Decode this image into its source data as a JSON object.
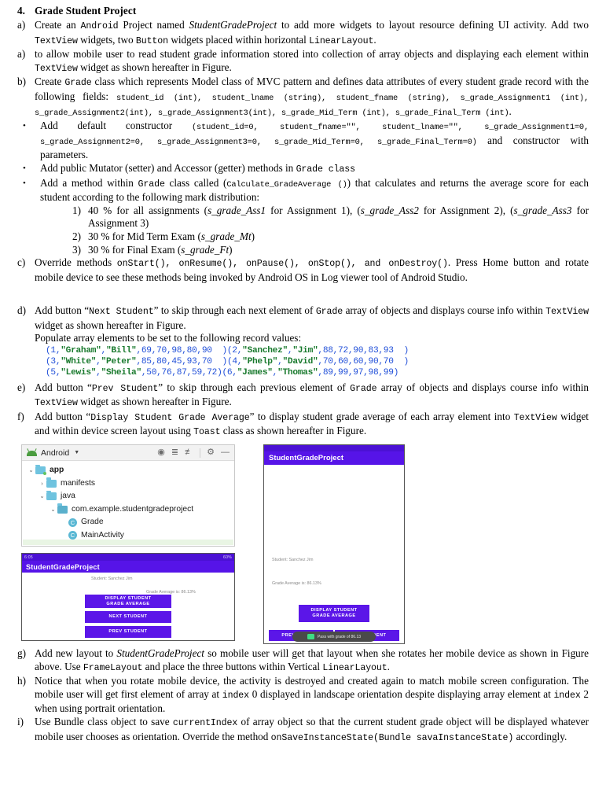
{
  "document": {
    "title_number": "4.",
    "title": "Grade Student Project",
    "items": [
      {
        "marker": "a)",
        "parts": [
          {
            "t": "Create an ",
            "s": "n"
          },
          {
            "t": "Android",
            "s": "m"
          },
          {
            "t": " Project named ",
            "s": "n"
          },
          {
            "t": "StudentGradeProject",
            "s": "i"
          },
          {
            "t": " to add more widgets to layout resource defining UI activity. Add two ",
            "s": "n"
          },
          {
            "t": "TextView",
            "s": "m"
          },
          {
            "t": " widgets, two ",
            "s": "n"
          },
          {
            "t": "Button",
            "s": "m"
          },
          {
            "t": "  widgets placed within horizontal ",
            "s": "n"
          },
          {
            "t": "LinearLayout",
            "s": "m"
          },
          {
            "t": ".",
            "s": "n"
          }
        ]
      },
      {
        "marker": "a)",
        "parts": [
          {
            "t": "to allow mobile user to read student grade information stored into collection of array objects and displaying each element within ",
            "s": "n"
          },
          {
            "t": "TextView",
            "s": "m"
          },
          {
            "t": " widget as shown hereafter in Figure.",
            "s": "n"
          }
        ]
      },
      {
        "marker": "b)",
        "parts": [
          {
            "t": "Create ",
            "s": "n"
          },
          {
            "t": "Grade",
            "s": "m"
          },
          {
            "t": " class which represents Model class of MVC pattern and defines data attributes of every student grade record with the following fields: ",
            "s": "n"
          },
          {
            "t": "student_id (int), student_lname (string), student_fname (string), s_grade_Assignment1 (int), s_grade_Assignment2(int), s_grade_Assignment3(int), s_grade_Mid_Term (int),  s_grade_Final_Term (int)",
            "s": "ms"
          },
          {
            "t": ".",
            "s": "n"
          }
        ]
      },
      {
        "marker": "•",
        "parts": [
          {
            "t": "Add default constructor ",
            "s": "n"
          },
          {
            "t": "(student_id=0,    student_fname=\"\",    student_lname=\"\", s_grade_Assignment1=0,            s_grade_Assignment2=0,            s_grade_Assignment3=0, s_grade_Mid_Term=0,  s_grade_Final_Term=0)",
            "s": "ms"
          },
          {
            "t": " and constructor with parameters.",
            "s": "n"
          }
        ]
      },
      {
        "marker": "•",
        "parts": [
          {
            "t": "Add public Mutator (setter) and Accessor (getter) methods in ",
            "s": "n"
          },
          {
            "t": "Grade  class",
            "s": "m"
          }
        ]
      },
      {
        "marker": "•",
        "parts": [
          {
            "t": "Add a method within ",
            "s": "n"
          },
          {
            "t": "Grade",
            "s": "m"
          },
          {
            "t": " class called (",
            "s": "n"
          },
          {
            "t": "Calculate_GradeAverage ()",
            "s": "ms"
          },
          {
            "t": ") that calculates and returns the average score for each student according to the following mark distribution:",
            "s": "n"
          }
        ]
      }
    ],
    "sub_items": [
      {
        "marker": "1)",
        "parts": [
          {
            "t": "40 % for all assignments (",
            "s": "n"
          },
          {
            "t": "s_grade_Ass1",
            "s": "i"
          },
          {
            "t": "  for Assignment 1), (",
            "s": "n"
          },
          {
            "t": "s_grade_Ass2",
            "s": "i"
          },
          {
            "t": " for Assignment 2), (",
            "s": "n"
          },
          {
            "t": "s_grade_Ass3",
            "s": "i"
          },
          {
            "t": " for Assignment 3)",
            "s": "n"
          }
        ]
      },
      {
        "marker": "2)",
        "parts": [
          {
            "t": "30 % for Mid Term Exam (",
            "s": "n"
          },
          {
            "t": "s_grade_Mt",
            "s": "i"
          },
          {
            "t": ")",
            "s": "n"
          }
        ]
      },
      {
        "marker": "3)",
        "parts": [
          {
            "t": "30 % for Final Exam (",
            "s": "n"
          },
          {
            "t": "s_grade_Ft",
            "s": "i"
          },
          {
            "t": ")",
            "s": "n"
          }
        ]
      }
    ],
    "item_c": {
      "marker": "c)",
      "parts": [
        {
          "t": "Override methods ",
          "s": "n"
        },
        {
          "t": "onStart(),  onResume(),  onPause(),  onStop(),  and onDestroy()",
          "s": "m"
        },
        {
          "t": ". Press Home button and rotate mobile device to see these methods being invoked by Android OS in Log viewer tool of Android Studio.",
          "s": "n"
        }
      ]
    },
    "item_d": {
      "marker": "d)",
      "parts": [
        {
          "t": "Add button “",
          "s": "n"
        },
        {
          "t": "Next Student",
          "s": "m"
        },
        {
          "t": "” to skip through each next element of ",
          "s": "n"
        },
        {
          "t": "Grade",
          "s": "m"
        },
        {
          "t": " array of objects and displays course info within ",
          "s": "n"
        },
        {
          "t": "TextView",
          "s": "m"
        },
        {
          "t": " widget as shown hereafter in Figure.",
          "s": "n"
        }
      ]
    },
    "populate_label": "Populate array elements to be set to the following record values:",
    "item_e": {
      "marker": "e)",
      "parts": [
        {
          "t": "Add button “",
          "s": "n"
        },
        {
          "t": "Prev Student",
          "s": "m"
        },
        {
          "t": "” to skip through each previous element of ",
          "s": "n"
        },
        {
          "t": "Grade",
          "s": "m"
        },
        {
          "t": " array of objects and displays course info within ",
          "s": "n"
        },
        {
          "t": "TextView",
          "s": "m"
        },
        {
          "t": " widget as shown hereafter in Figure.",
          "s": "n"
        }
      ]
    },
    "item_f": {
      "marker": "f)",
      "parts": [
        {
          "t": "Add button “",
          "s": "n"
        },
        {
          "t": "Display Student Grade Average",
          "s": "m"
        },
        {
          "t": "” to display student grade average of each array element into ",
          "s": "n"
        },
        {
          "t": "TextView",
          "s": "m"
        },
        {
          "t": " widget and within device screen layout using ",
          "s": "n"
        },
        {
          "t": "Toast",
          "s": "m"
        },
        {
          "t": " class as shown hereafter in Figure.",
          "s": "n"
        }
      ]
    },
    "item_g": {
      "marker": "g)",
      "parts": [
        {
          "t": "Add new layout to ",
          "s": "n"
        },
        {
          "t": "StudentGradeProject",
          "s": "i"
        },
        {
          "t": " so mobile user will get that layout when she rotates her mobile device as shown in Figure above. Use ",
          "s": "n"
        },
        {
          "t": "FrameLayout",
          "s": "m"
        },
        {
          "t": " and place the three buttons within Vertical ",
          "s": "n"
        },
        {
          "t": "LinearLayout",
          "s": "m"
        },
        {
          "t": ".",
          "s": "n"
        }
      ]
    },
    "item_h": {
      "marker": "h)",
      "parts": [
        {
          "t": "Notice that when you rotate mobile device, the activity is destroyed and created again to match mobile screen configuration. The mobile user will get first element of array at ",
          "s": "n"
        },
        {
          "t": "index",
          "s": "m"
        },
        {
          "t": " 0 displayed in landscape orientation despite displaying array element at ",
          "s": "n"
        },
        {
          "t": "index",
          "s": "m"
        },
        {
          "t": " 2 when using portrait orientation.",
          "s": "n"
        }
      ]
    },
    "item_i": {
      "marker": "i)",
      "parts": [
        {
          "t": "Use Bundle class object to save ",
          "s": "n"
        },
        {
          "t": "currentIndex",
          "s": "m"
        },
        {
          "t": " of array object so that the current student grade object will be displayed whatever mobile user chooses as orientation. Override the method ",
          "s": "n"
        },
        {
          "t": "onSaveInstanceState(Bundle  savaInstanceState)",
          "s": "m"
        },
        {
          "t": " accordingly.",
          "s": "n"
        }
      ]
    },
    "records": [
      [
        {
          "t": "(1,",
          "c": "blue"
        },
        {
          "t": "\"Graham\"",
          "c": "green"
        },
        {
          "t": ",",
          "c": "blue"
        },
        {
          "t": "\"Bill\"",
          "c": "green"
        },
        {
          "t": ",69,70,98,80,90  )",
          "c": "blue"
        },
        {
          "t": "(2,",
          "c": "blue"
        },
        {
          "t": "\"Sanchez\"",
          "c": "green"
        },
        {
          "t": ",",
          "c": "blue"
        },
        {
          "t": "\"Jim\"",
          "c": "green"
        },
        {
          "t": ",88,72,90,83,93  )",
          "c": "blue"
        }
      ],
      [
        {
          "t": "(3,",
          "c": "blue"
        },
        {
          "t": "\"White\"",
          "c": "green"
        },
        {
          "t": ",",
          "c": "blue"
        },
        {
          "t": "\"Peter\"",
          "c": "green"
        },
        {
          "t": ",85,80,45,93,70  )",
          "c": "blue"
        },
        {
          "t": "(4,",
          "c": "blue"
        },
        {
          "t": "\"Phelp\"",
          "c": "green"
        },
        {
          "t": ",",
          "c": "blue"
        },
        {
          "t": "\"David\"",
          "c": "green"
        },
        {
          "t": ",70,60,60,90,70  )",
          "c": "blue"
        }
      ],
      [
        {
          "t": "(5,",
          "c": "blue"
        },
        {
          "t": "\"Lewis\"",
          "c": "green"
        },
        {
          "t": ",",
          "c": "blue"
        },
        {
          "t": "\"Sheila\"",
          "c": "green"
        },
        {
          "t": ",50,76,87,59,72)",
          "c": "blue"
        },
        {
          "t": "(6,",
          "c": "blue"
        },
        {
          "t": "\"James\"",
          "c": "green"
        },
        {
          "t": ",",
          "c": "blue"
        },
        {
          "t": "\"Thomas\"",
          "c": "green"
        },
        {
          "t": ",89,99,97,98,99)",
          "c": "blue"
        }
      ]
    ]
  },
  "android_studio": {
    "toolbar_title": "Android",
    "icons": [
      "target-icon",
      "collapse-all-icon",
      "expand-all-icon",
      "gear-icon",
      "minimize-icon"
    ],
    "tree": [
      {
        "label": "app",
        "depth": 0,
        "arrow": "⌄",
        "kind": "folder-green",
        "bold": true
      },
      {
        "label": "manifests",
        "depth": 1,
        "arrow": "›",
        "kind": "folder",
        "bold": false
      },
      {
        "label": "java",
        "depth": 1,
        "arrow": "⌄",
        "kind": "folder",
        "bold": false
      },
      {
        "label": "com.example.studentgradeproject",
        "depth": 2,
        "arrow": "⌄",
        "kind": "folder-dark",
        "bold": false
      },
      {
        "label": "Grade",
        "depth": 3,
        "arrow": "",
        "kind": "class",
        "bold": false
      },
      {
        "label": "MainActivity",
        "depth": 3,
        "arrow": "",
        "kind": "class",
        "bold": false
      }
    ],
    "class_badge": "C"
  },
  "phone_landscape": {
    "status_time": "6:05",
    "status_right": "60%",
    "app_title": "StudentGradeProject",
    "student_label": "Student: Sanchez Jim",
    "average_label": "Grade Average is: 86.13%",
    "buttons": [
      {
        "line1": "DISPLAY STUDENT",
        "line2": "GRADE AVERAGE"
      },
      {
        "line1": "NEXT STUDENT",
        "line2": ""
      },
      {
        "line1": "PREV STUDENT",
        "line2": ""
      }
    ]
  },
  "phone_portrait": {
    "status_time": "",
    "app_title": "StudentGradeProject",
    "student_label": "Student: Sanchez Jim",
    "average_label": "Grade Average is: 86.13%",
    "display_button": {
      "line1": "DISPLAY STUDENT",
      "line2": "GRADE AVERAGE"
    },
    "prev_button": "PREV STUDENT",
    "next_button": "NEXT STUDENT",
    "toast_text": "Pass with grade of 86.13"
  },
  "colors": {
    "accent_purple": "#5614e8",
    "status_purple": "#4b11d4",
    "toast_green": "#3ddc84",
    "code_blue": "#1f4ed8",
    "code_green": "#1a7a2e"
  }
}
